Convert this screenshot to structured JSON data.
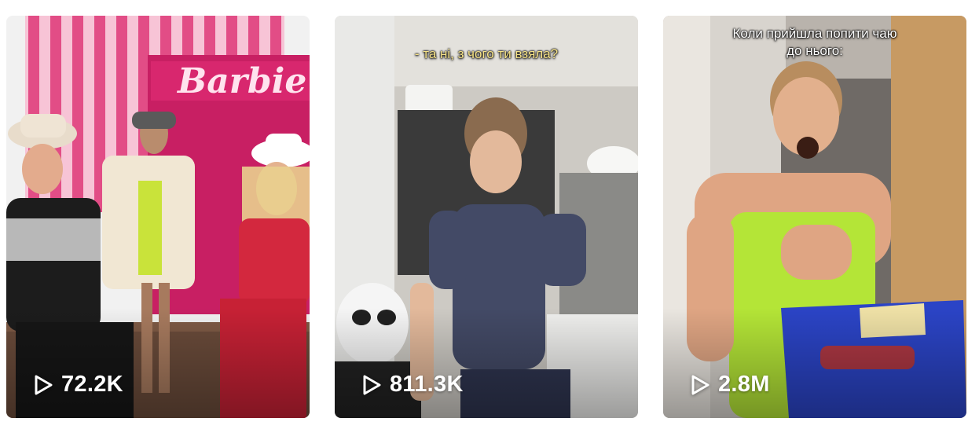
{
  "videos": [
    {
      "views": "72.2K",
      "scene_text": "Barbie",
      "icon": "play-icon"
    },
    {
      "views": "811.3K",
      "caption": "- та ні, з чого ти взяла?",
      "icon": "play-icon"
    },
    {
      "views": "2.8M",
      "caption_lines": [
        "Коли прийшла попити чаю",
        "до нього:"
      ],
      "icon": "play-icon"
    }
  ],
  "colors": {
    "overlay_text": "#ffffff",
    "caption_yellow": "#f6e389",
    "barbie_pink": "#d8276e"
  }
}
